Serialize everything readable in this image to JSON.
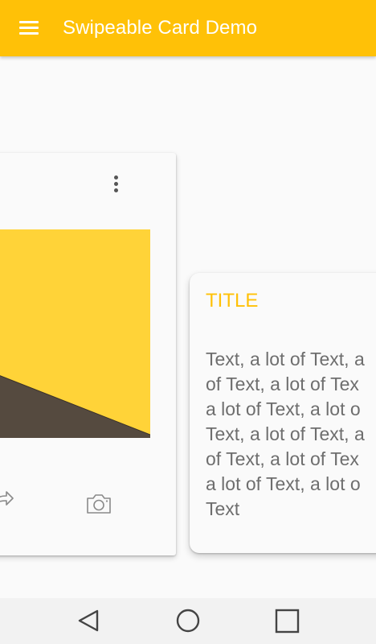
{
  "app": {
    "title": "Swipeable Card Demo",
    "accent_color": "#FFC107"
  },
  "appbar": {
    "menu_icon": "hamburger-menu-icon"
  },
  "left_card": {
    "menu_icon": "more-vertical-icon",
    "image": "abstract-yellow-landscape-image",
    "actions": [
      {
        "icon": "share-icon"
      },
      {
        "icon": "camera-icon"
      }
    ]
  },
  "right_card": {
    "title": "TITLE",
    "text": "Text, a lot of Text, a\nof Text, a lot of Tex\na lot of Text, a lot o\nText, a lot of Text, a\nof Text, a lot of Tex\na lot of Text, a lot o\nText"
  },
  "navbar": {
    "buttons": [
      "back-triangle-icon",
      "home-circle-icon",
      "recents-square-icon"
    ]
  }
}
